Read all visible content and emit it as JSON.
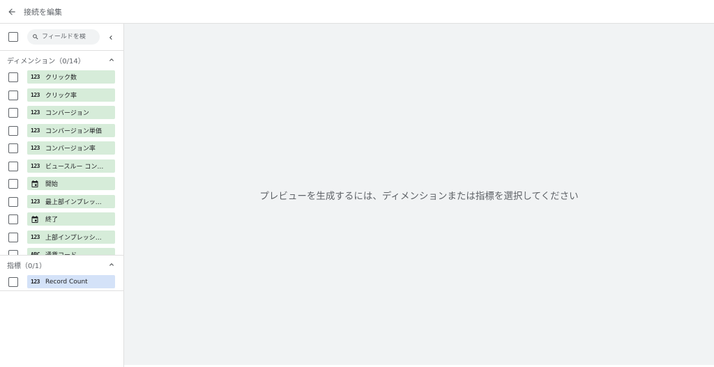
{
  "header": {
    "back_icon": "arrow-back-icon",
    "title": "接続を編集"
  },
  "sidebar": {
    "search": {
      "placeholder": "フィールドを検",
      "icon": "search-icon"
    },
    "collapse_icon": "chevron-left-icon",
    "dimensions": {
      "header": "ディメンション（0/14）",
      "items": [
        {
          "type": "123",
          "label": "クリック数"
        },
        {
          "type": "123",
          "label": "クリック率"
        },
        {
          "type": "123",
          "label": "コンバージョン"
        },
        {
          "type": "123",
          "label": "コンバージョン単価"
        },
        {
          "type": "123",
          "label": "コンバージョン率"
        },
        {
          "type": "123",
          "label": "ビュースルー コン…"
        },
        {
          "type": "calendar",
          "label": "開始"
        },
        {
          "type": "123",
          "label": "最上部インプレッ…"
        },
        {
          "type": "calendar",
          "label": "終了"
        },
        {
          "type": "123",
          "label": "上部インプレッシ…"
        },
        {
          "type": "ABC",
          "label": "通貨コード"
        }
      ]
    },
    "metrics": {
      "header": "指標（0/1）",
      "items": [
        {
          "type": "123",
          "label": "Record Count"
        }
      ]
    }
  },
  "main": {
    "message": "プレビューを生成するには、ディメンションまたは指標を選択してください"
  },
  "colors": {
    "dimension_chip": "#d6ecd9",
    "metric_chip": "#d4e2f8",
    "canvas": "#f1f3f4"
  }
}
